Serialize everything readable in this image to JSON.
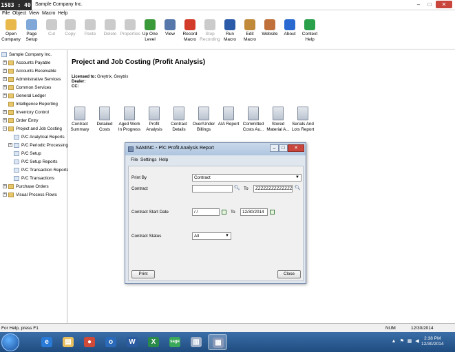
{
  "window": {
    "clock": "1583 : 40 : 15",
    "title": "Sample Company Inc.",
    "min_glyph": "–",
    "max_glyph": "□",
    "close_glyph": "✕"
  },
  "menu": [
    "File",
    "Object",
    "View",
    "Macro",
    "Help"
  ],
  "toolbar": [
    {
      "label": "Open\nCompany",
      "icon": "open-folder-icon",
      "color": "#e8b84a",
      "enabled": true
    },
    {
      "label": "Page\nSetup",
      "icon": "page-setup-icon",
      "color": "#7fa7d8",
      "enabled": true
    },
    {
      "label": "Cut",
      "icon": "scissors-icon",
      "color": "#a0a0a0",
      "enabled": false
    },
    {
      "label": "Copy",
      "icon": "copy-icon",
      "color": "#a0a0a0",
      "enabled": false
    },
    {
      "label": "Paste",
      "icon": "paste-icon",
      "color": "#a0a0a0",
      "enabled": false
    },
    {
      "label": "Delete",
      "icon": "delete-x-icon",
      "color": "#a0a0a0",
      "enabled": false
    },
    {
      "label": "Properties",
      "icon": "properties-icon",
      "color": "#a0a0a0",
      "enabled": false
    },
    {
      "label": "Up One\nLevel",
      "icon": "up-level-icon",
      "color": "#3a9a3a",
      "enabled": true
    },
    {
      "label": "View",
      "icon": "view-icon",
      "color": "#5577aa",
      "enabled": true
    },
    {
      "label": "Record\nMacro",
      "icon": "record-icon",
      "color": "#d23a2a",
      "enabled": true
    },
    {
      "label": "Stop\nRecording",
      "icon": "stop-icon",
      "color": "#a0a0a0",
      "enabled": false
    },
    {
      "label": "Run\nMacro",
      "icon": "play-icon",
      "color": "#2a5aa8",
      "enabled": true
    },
    {
      "label": "Edit\nMacro",
      "icon": "edit-macro-icon",
      "color": "#c08a3a",
      "enabled": true
    },
    {
      "label": "Website",
      "icon": "home-icon",
      "color": "#c0703a",
      "enabled": true
    },
    {
      "label": "About",
      "icon": "info-icon",
      "color": "#2a6ad0",
      "enabled": true
    },
    {
      "label": "Context\nHelp",
      "icon": "help-icon",
      "color": "#2aa04a",
      "enabled": true
    }
  ],
  "tree": [
    {
      "label": "Sample Company Inc.",
      "level": 0,
      "exp": "",
      "type": "company"
    },
    {
      "label": "Accounts Payable",
      "level": 1,
      "exp": "+",
      "type": "folder"
    },
    {
      "label": "Accounts Receivable",
      "level": 1,
      "exp": "+",
      "type": "folder"
    },
    {
      "label": "Administrative Services",
      "level": 1,
      "exp": "+",
      "type": "folder"
    },
    {
      "label": "Common Services",
      "level": 1,
      "exp": "+",
      "type": "folder"
    },
    {
      "label": "General Ledger",
      "level": 1,
      "exp": "+",
      "type": "folder"
    },
    {
      "label": "Intelligence Reporting",
      "level": 1,
      "exp": "",
      "type": "special"
    },
    {
      "label": "Inventory Control",
      "level": 1,
      "exp": "+",
      "type": "folder"
    },
    {
      "label": "Order Entry",
      "level": 1,
      "exp": "+",
      "type": "folder"
    },
    {
      "label": "Project and Job Costing",
      "level": 1,
      "exp": "−",
      "type": "folder"
    },
    {
      "label": "P/C Analytical Reports",
      "level": 2,
      "exp": "",
      "type": "doc"
    },
    {
      "label": "P/C Periodic Processing",
      "level": 2,
      "exp": "+",
      "type": "doc"
    },
    {
      "label": "P/C Setup",
      "level": 2,
      "exp": "",
      "type": "doc"
    },
    {
      "label": "P/C Setup Reports",
      "level": 2,
      "exp": "",
      "type": "doc"
    },
    {
      "label": "P/C Transaction Reports",
      "level": 2,
      "exp": "",
      "type": "doc"
    },
    {
      "label": "P/C Transactions",
      "level": 2,
      "exp": "",
      "type": "doc"
    },
    {
      "label": "Purchase Orders",
      "level": 1,
      "exp": "+",
      "type": "folder"
    },
    {
      "label": "Visual Process Flows",
      "level": 1,
      "exp": "+",
      "type": "folder"
    }
  ],
  "main": {
    "title": "Project and Job Costing (Profit Analysis)",
    "licensed_label": "Licensed to:",
    "licensed_value": "Greytrix, Greytrix",
    "dealer_label": "Dealer:",
    "cc_label": "CC:",
    "reports": [
      "Contract\nSummary",
      "Detailed\nCosts",
      "Aged Work\nIn Progress",
      "Profit\nAnalysis",
      "Contract\nDetails",
      "Over/Under\nBillings",
      "AIA Report",
      "Committed\nCosts Au...",
      "Stored\nMaterial A...",
      "Serials And\nLots Report"
    ]
  },
  "dialog": {
    "title": "SAMINC - P/C Profit Analysis Report",
    "min_glyph": "–",
    "max_glyph": "□",
    "close_glyph": "✕",
    "menu": [
      "File",
      "Settings",
      "Help"
    ],
    "print_by_label": "Print By",
    "print_by_value": "Contract",
    "contract_label": "Contract",
    "contract_from": "",
    "to_label": "To",
    "contract_to": "ZZZZZZZZZZZZZZZZZ",
    "start_date_label": "Contract Start Date",
    "start_date_from": " /  /",
    "start_date_to": "12/30/2014",
    "status_label": "Contract Status",
    "status_value": "All",
    "print_button": "Print",
    "close_button": "Close"
  },
  "status": {
    "help_text": "For Help, press F1",
    "num": "NUM",
    "date": "12/30/2014"
  },
  "taskbar": {
    "apps": [
      {
        "icon": "internet-explorer-icon",
        "glyph": "e",
        "color": "#2a7ad8",
        "active": false
      },
      {
        "icon": "file-explorer-icon",
        "glyph": "▤",
        "color": "#e8c060",
        "active": false
      },
      {
        "icon": "chrome-icon",
        "glyph": "●",
        "color": "#d04a3a",
        "active": false
      },
      {
        "icon": "outlook-icon",
        "glyph": "o",
        "color": "#2a6ab8",
        "active": false
      },
      {
        "icon": "word-icon",
        "glyph": "W",
        "color": "#2a5aa0",
        "active": false
      },
      {
        "icon": "excel-icon",
        "glyph": "X",
        "color": "#2a8a4a",
        "active": false
      },
      {
        "icon": "sage-icon",
        "glyph": "sage",
        "color": "#3aa85a",
        "active": false
      },
      {
        "icon": "database-icon",
        "glyph": "▥",
        "color": "#a0b0c8",
        "active": false
      },
      {
        "icon": "sage-300-icon",
        "glyph": "▦",
        "color": "#8a9ab8",
        "active": true
      }
    ],
    "time": "2:38 PM",
    "date": "12/30/2014"
  }
}
